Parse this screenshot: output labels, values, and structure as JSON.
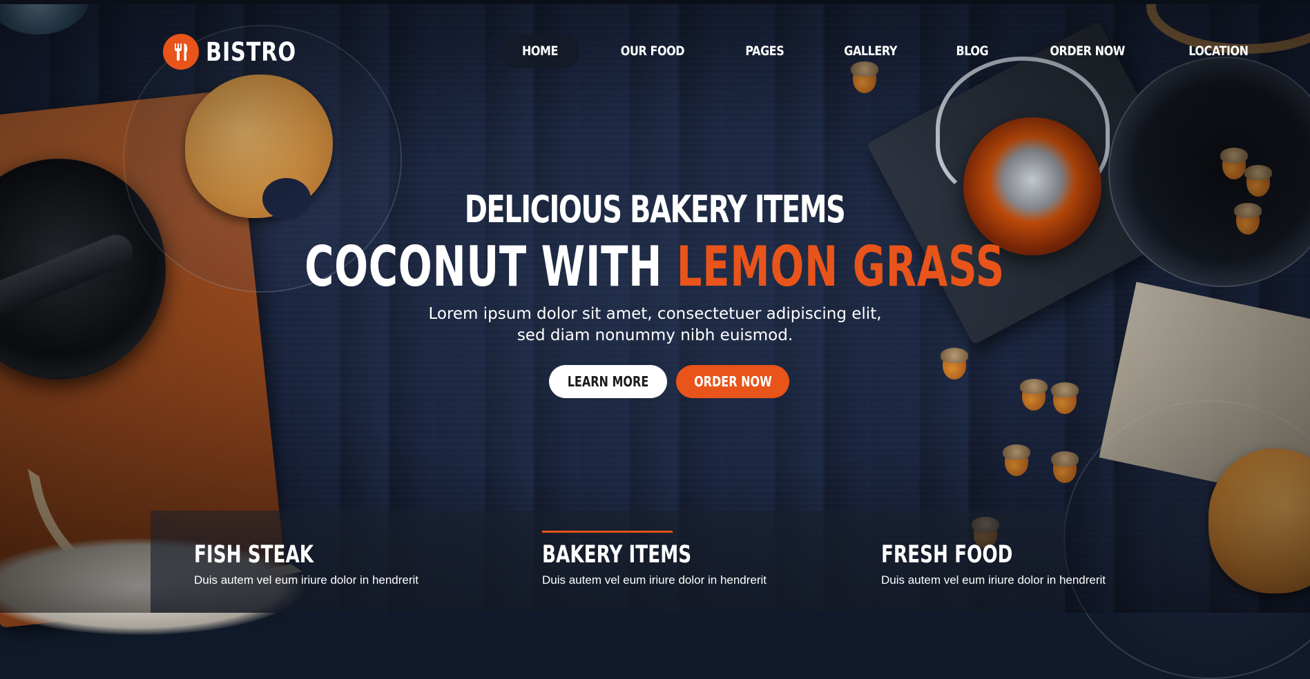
{
  "brand": {
    "name": "BISTRO",
    "accent_color": "#e8541a",
    "logo_icon": "fork-knife-icon"
  },
  "nav": {
    "items": [
      {
        "label": "HOME",
        "active": true
      },
      {
        "label": "OUR FOOD",
        "active": false
      },
      {
        "label": "PAGES",
        "active": false
      },
      {
        "label": "GALLERY",
        "active": false
      },
      {
        "label": "BLOG",
        "active": false
      },
      {
        "label": "ORDER NOW",
        "active": false
      },
      {
        "label": "LOCATION",
        "active": false
      }
    ]
  },
  "hero": {
    "subtitle": "DELICIOUS BAKERY ITEMS",
    "title_white": "COCONUT WITH",
    "title_orange": "LEMON GRASS",
    "description_line1": "Lorem ipsum dolor sit amet, consectetuer adipiscing elit,",
    "description_line2": "sed diam nonummy nibh euismod.",
    "learn_more_label": "LEARN MORE",
    "order_now_label": "ORDER NOW"
  },
  "features": [
    {
      "title": "FISH STEAK",
      "text": "Duis autem vel eum iriure dolor in hendrerit",
      "highlighted": false
    },
    {
      "title": "BAKERY ITEMS",
      "text": "Duis autem vel eum iriure dolor in hendrerit",
      "highlighted": true
    },
    {
      "title": "FRESH FOOD",
      "text": "Duis autem vel eum iriure dolor in hendrerit",
      "highlighted": false
    }
  ]
}
